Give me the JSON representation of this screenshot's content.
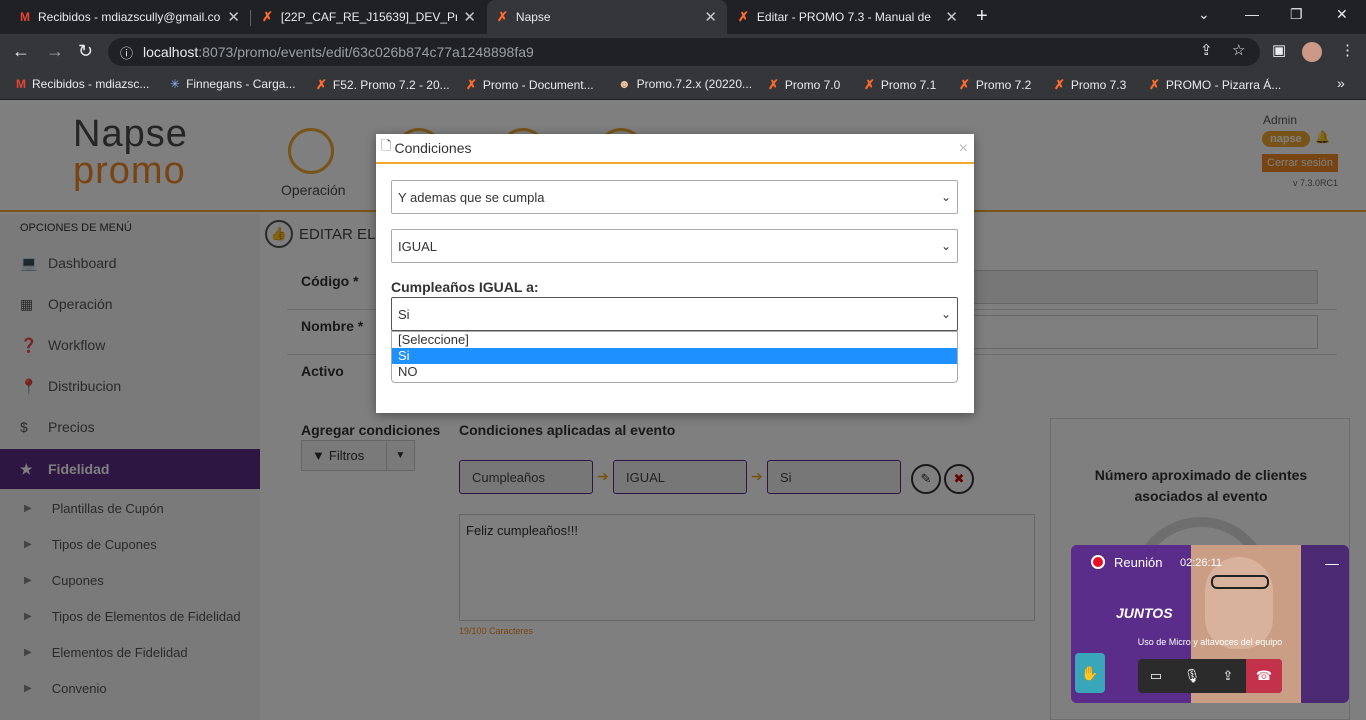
{
  "browser": {
    "tabs": [
      {
        "title": "Recibidos - mdiazscully@gmail.co",
        "icon": "gmail-icon"
      },
      {
        "title": "[22P_CAF_RE_J15639]_DEV_Prom",
        "icon": "x-logo-icon"
      },
      {
        "title": "Napse",
        "icon": "x-logo-icon"
      },
      {
        "title": "Editar - PROMO 7.3 - Manual de",
        "icon": "x-logo-icon"
      }
    ],
    "url_host": "localhost",
    "url_path": ":8073/promo/events/edit/63c026b874c77a1248898fa9",
    "bookmarks": [
      "Recibidos - mdiazsc...",
      "Finnegans - Carga...",
      "F52. Promo 7.2 - 20...",
      "Promo - Document...",
      "Promo.7.2.x (20220...",
      "Promo 7.0",
      "Promo 7.1",
      "Promo 7.2",
      "Promo 7.3",
      "PROMO - Pizarra Á..."
    ]
  },
  "header": {
    "logo_top": "Napse",
    "logo_bottom": "promo",
    "module_label": "Operación",
    "user": "Admin",
    "badge": "napse",
    "logout": "Cerrar sesión",
    "version": "v 7.3.0RC1"
  },
  "sidebar": {
    "title": "OPCIONES DE MENÚ",
    "items": [
      {
        "label": "Dashboard",
        "icon": "laptop-icon"
      },
      {
        "label": "Operación",
        "icon": "grid-icon"
      },
      {
        "label": "Workflow",
        "icon": "question-icon"
      },
      {
        "label": "Distribucion",
        "icon": "pin-icon"
      },
      {
        "label": "Precios",
        "icon": "dollar-icon"
      },
      {
        "label": "Fidelidad",
        "icon": "star-icon"
      }
    ],
    "subitems": [
      "Plantillas de Cupón",
      "Tipos de Cupones",
      "Cupones",
      "Tipos de Elementos de Fidelidad",
      "Elementos de Fidelidad",
      "Convenio"
    ]
  },
  "content": {
    "title": "EDITAR EL I",
    "fields": {
      "code": "Código *",
      "name": "Nombre *",
      "active": "Activo"
    },
    "add_conditions": "Agregar condiciones",
    "filters_button": "Filtros",
    "applied_conditions": "Condiciones aplicadas al evento",
    "chips": [
      "Cumpleaños",
      "IGUAL",
      "Si"
    ],
    "message": "Feliz cumpleaños!!!",
    "char_count": "19/100 Caracteres",
    "clients_panel_title": "Número aproximado de clientes asociados al evento"
  },
  "modal": {
    "title": "Condiciones",
    "select1": "Y ademas que se cumpla",
    "select2": "IGUAL",
    "label": "Cumpleaños IGUAL a:",
    "select3": "Si",
    "options": [
      "[Seleccione]",
      "Si",
      "NO"
    ],
    "selected_option": "Si"
  },
  "call": {
    "title": "Reunión",
    "time": "02:26:11",
    "caption": "Uso de Micro y altavoces del equipo",
    "brand": "JUNTOS"
  },
  "colors": {
    "accent_orange": "#f0a830",
    "brand_purple": "#5a2d82",
    "selection_blue": "#1e90ff"
  }
}
